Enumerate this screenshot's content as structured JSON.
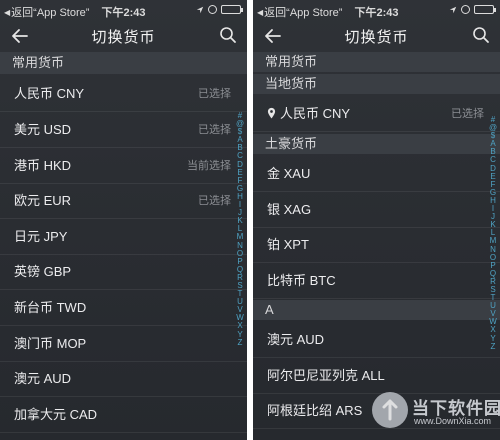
{
  "statusbar": {
    "back_text": "返回“App Store”",
    "time": "下午2:43",
    "battery_level": 0.9
  },
  "left": {
    "title": "切换货币",
    "section_title": "常用货币",
    "rows": [
      {
        "name": "人民币 CNY",
        "status": "已选择"
      },
      {
        "name": "美元 USD",
        "status": "已选择"
      },
      {
        "name": "港币 HKD",
        "status": "当前选择"
      },
      {
        "name": "欧元 EUR",
        "status": "已选择"
      },
      {
        "name": "日元 JPY",
        "status": ""
      },
      {
        "name": "英镑 GBP",
        "status": ""
      },
      {
        "name": "新台币 TWD",
        "status": ""
      },
      {
        "name": "澳门币 MOP",
        "status": ""
      },
      {
        "name": "澳元 AUD",
        "status": ""
      },
      {
        "name": "加拿大元 CAD",
        "status": ""
      }
    ]
  },
  "right": {
    "title": "切换货币",
    "sections": {
      "common": "常用货币",
      "local": "当地货币",
      "local_row": {
        "name": "人民币 CNY",
        "status": "已选择"
      },
      "tuhao": "土豪货币",
      "tuhao_rows": [
        "金 XAU",
        "银 XAG",
        "铂 XPT",
        "比特币 BTC"
      ],
      "a": "A",
      "a_rows": [
        "澳元 AUD",
        "阿尔巴尼亚列克 ALL",
        "阿根廷比绍 ARS"
      ]
    }
  },
  "index_letters": [
    "#",
    "@",
    "$",
    "A",
    "B",
    "C",
    "D",
    "E",
    "F",
    "G",
    "H",
    "I",
    "J",
    "K",
    "L",
    "M",
    "N",
    "O",
    "P",
    "Q",
    "R",
    "S",
    "T",
    "U",
    "V",
    "W",
    "X",
    "Y",
    "Z"
  ],
  "watermark": {
    "name": "当下软件园",
    "domain": "www.DownXia.com"
  },
  "colors": {
    "background": "#2b2e33",
    "section_header": "#3a3e44",
    "index_accent": "#4fa3c4",
    "status_text": "#8b8e93"
  }
}
